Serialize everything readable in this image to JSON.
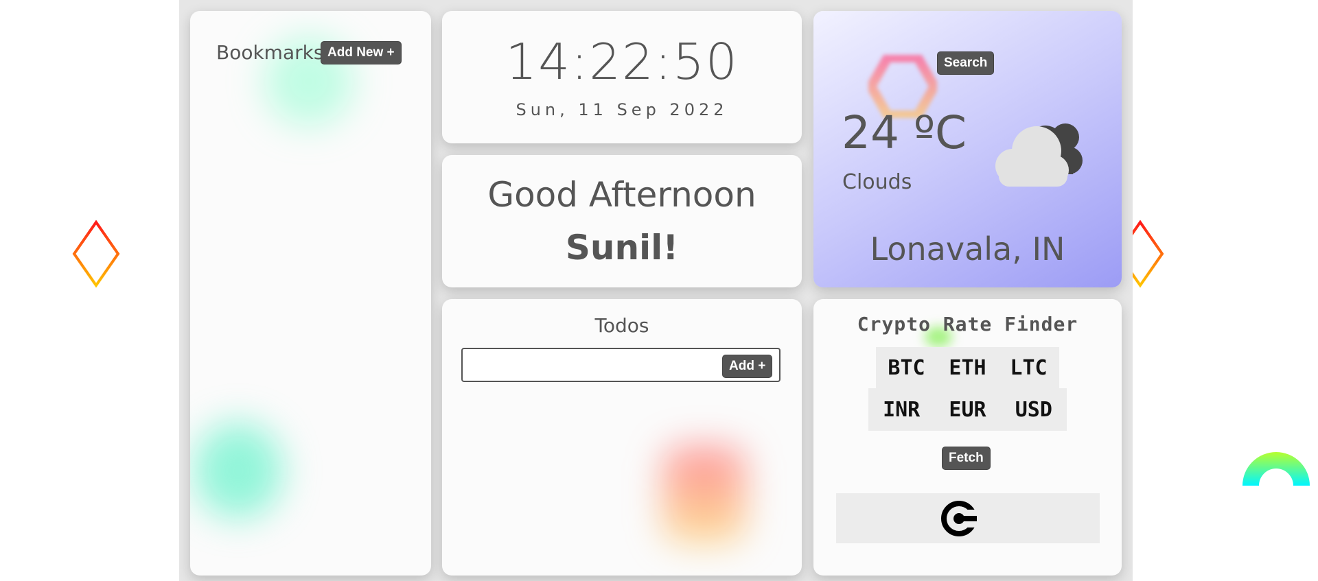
{
  "bookmarks": {
    "title": "Bookmarks",
    "add_label": "Add New +"
  },
  "clock": {
    "time": "14:22:50",
    "date": "Sun, 11 Sep 2022"
  },
  "greeting": {
    "line1": "Good Afternoon",
    "name": "Sunil!"
  },
  "weather": {
    "search_label": "Search",
    "temperature": "24 ºC",
    "condition": "Clouds",
    "location": "Lonavala, IN",
    "icon": "cloud-icon"
  },
  "todos": {
    "title": "Todos",
    "add_label": "Add +",
    "input_value": ""
  },
  "crypto": {
    "title": "Crypto Rate Finder",
    "coins": [
      "BTC",
      "ETH",
      "LTC"
    ],
    "currencies": [
      "INR",
      "EUR",
      "USD"
    ],
    "fetch_label": "Fetch",
    "logo_icon": "coin-logo-icon"
  },
  "colors": {
    "accent_button": "#555555",
    "weather_gradient_end": "#9c9cf5"
  }
}
